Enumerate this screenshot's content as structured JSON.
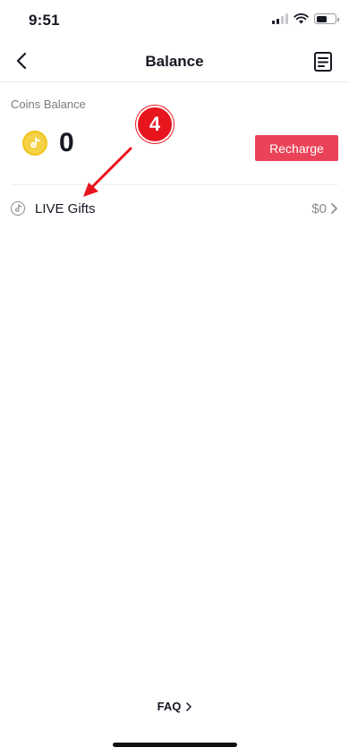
{
  "status_bar": {
    "time": "9:51"
  },
  "header": {
    "title": "Balance"
  },
  "balance": {
    "label": "Coins Balance",
    "value": "0",
    "recharge_label": "Recharge"
  },
  "gifts": {
    "label": "LIVE Gifts",
    "amount": "$0"
  },
  "annotation": {
    "step": "4"
  },
  "footer": {
    "faq_label": "FAQ"
  },
  "colors": {
    "accent": "#ea4359",
    "annotation": "#e8141e",
    "coin": "#f5d146"
  }
}
